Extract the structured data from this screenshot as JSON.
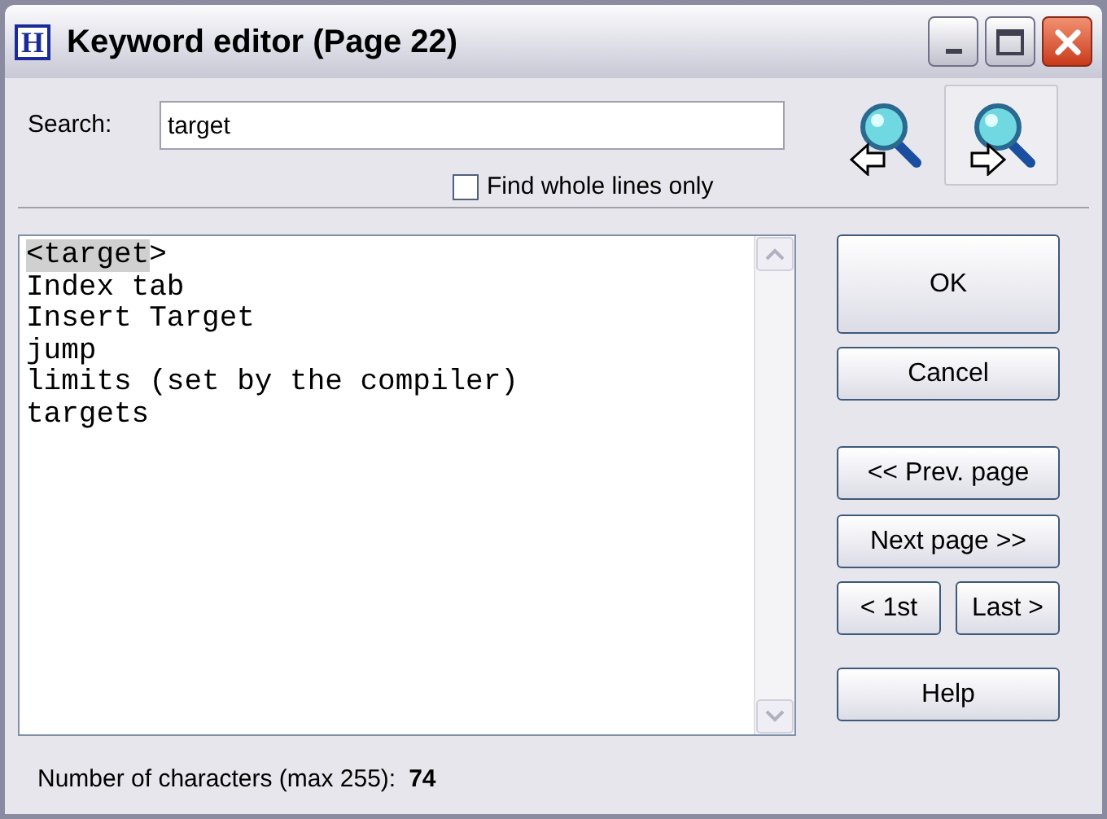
{
  "window": {
    "title": "Keyword editor (Page 22)",
    "icon_letter": "H"
  },
  "search": {
    "label": "Search:",
    "value": "target"
  },
  "whole_lines": {
    "label": "Find whole lines only",
    "checked": false
  },
  "find_buttons": [
    {
      "kind": "back",
      "pressed": false
    },
    {
      "kind": "forward",
      "pressed": true
    }
  ],
  "keywords": [
    {
      "parts": [
        {
          "text": "<target",
          "highlighted": true
        },
        {
          "text": ">",
          "highlighted": false
        }
      ]
    },
    {
      "parts": [
        {
          "text": "Index tab",
          "highlighted": false
        }
      ]
    },
    {
      "parts": [
        {
          "text": "Insert Target",
          "highlighted": false
        }
      ]
    },
    {
      "parts": [
        {
          "text": "jump",
          "highlighted": false
        }
      ]
    },
    {
      "parts": [
        {
          "text": "limits (set by the compiler)",
          "highlighted": false
        }
      ]
    },
    {
      "parts": [
        {
          "text": "targets",
          "highlighted": false
        }
      ]
    }
  ],
  "buttons": {
    "ok": "OK",
    "cancel": "Cancel",
    "prev": "<< Prev. page",
    "next": "Next page >>",
    "first": "< 1st",
    "last": "Last >",
    "help": "Help"
  },
  "status": {
    "label": "Number of characters (max 255):",
    "count": "74"
  }
}
